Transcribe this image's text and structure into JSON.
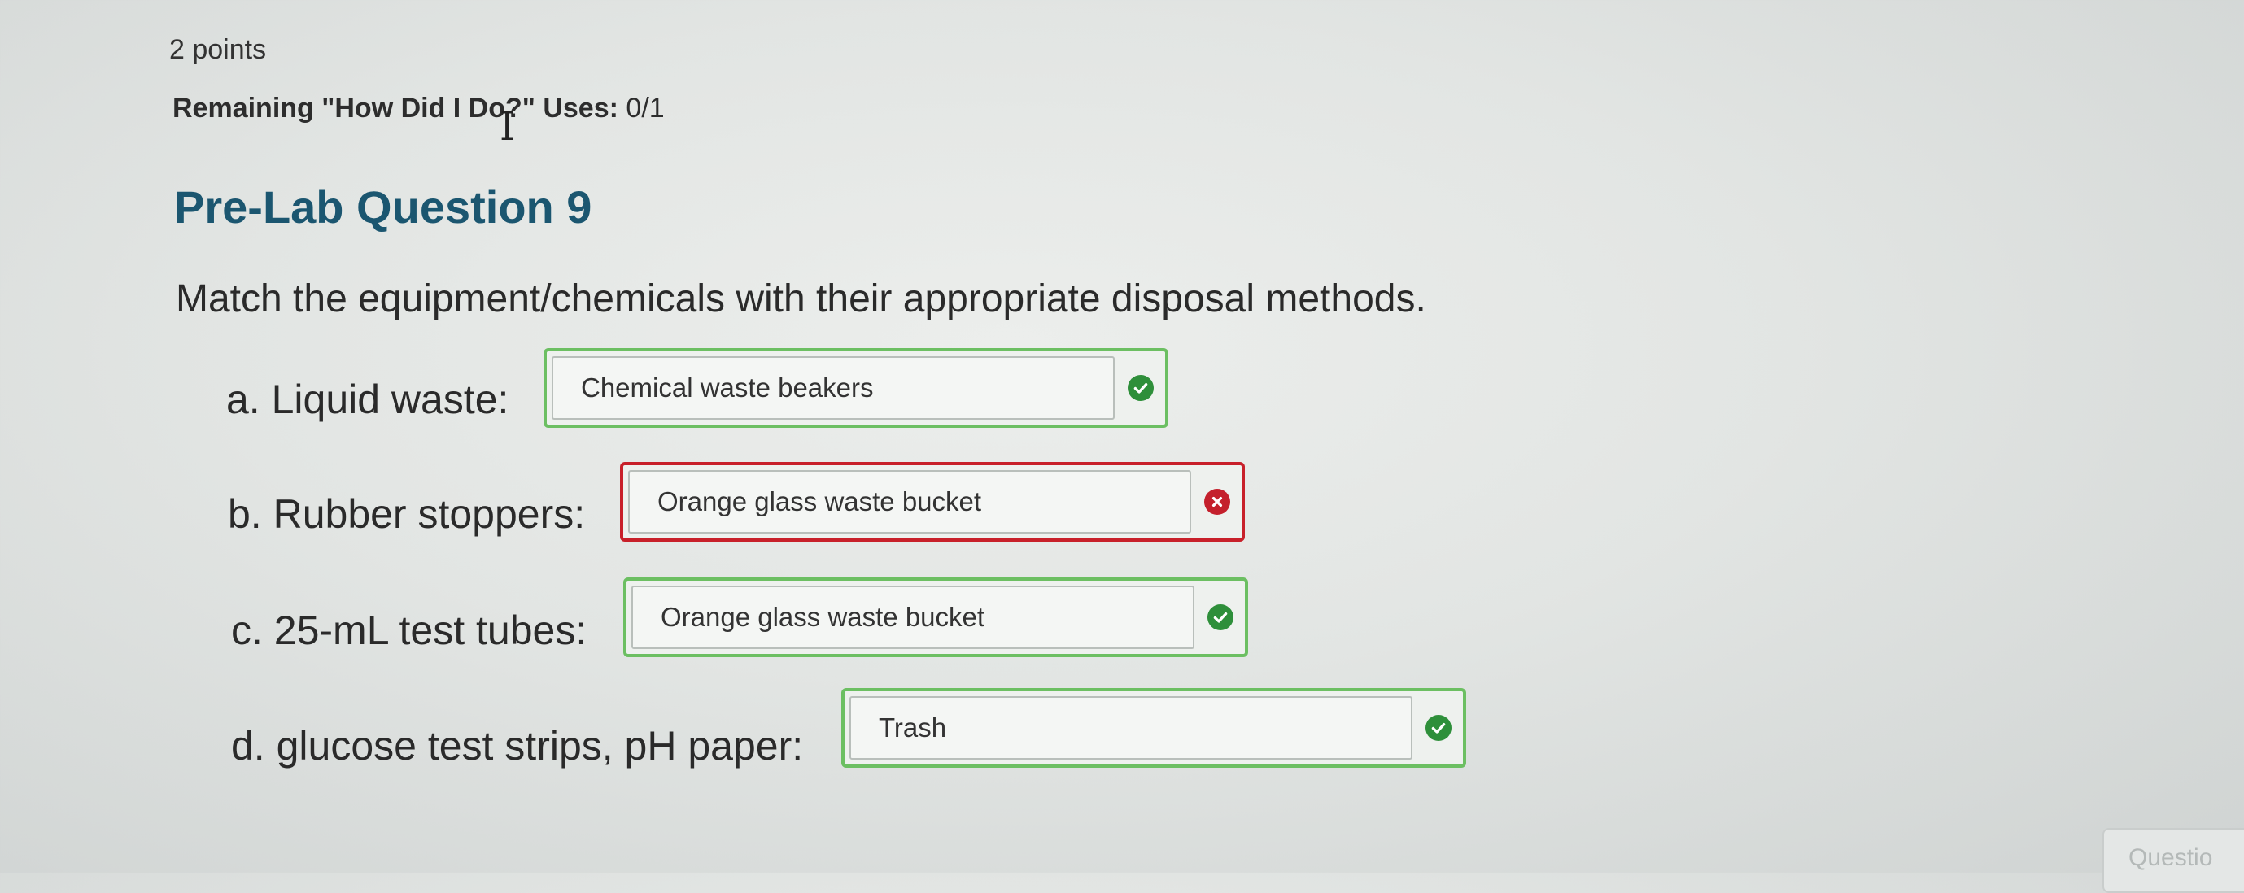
{
  "header": {
    "points": "2 points",
    "uses_label": "Remaining \"How Did I Do?\" Uses:",
    "uses_value": "0/1"
  },
  "question": {
    "title": "Pre-Lab Question 9",
    "prompt": "Match the equipment/chemicals with their appropriate disposal methods."
  },
  "items": [
    {
      "label": "a. Liquid waste:",
      "value": "Chemical waste beakers",
      "status": "correct"
    },
    {
      "label": "b. Rubber stoppers:",
      "value": "Orange glass waste bucket",
      "status": "incorrect"
    },
    {
      "label": "c. 25-mL test tubes:",
      "value": "Orange glass waste bucket",
      "status": "correct"
    },
    {
      "label": "d. glucose test strips, pH paper:",
      "value": "Trash",
      "status": "correct"
    }
  ],
  "footer": {
    "button_label": "Questio"
  },
  "colors": {
    "title": "#1b5670",
    "correct": "#6cbf62",
    "incorrect": "#c8202a"
  }
}
